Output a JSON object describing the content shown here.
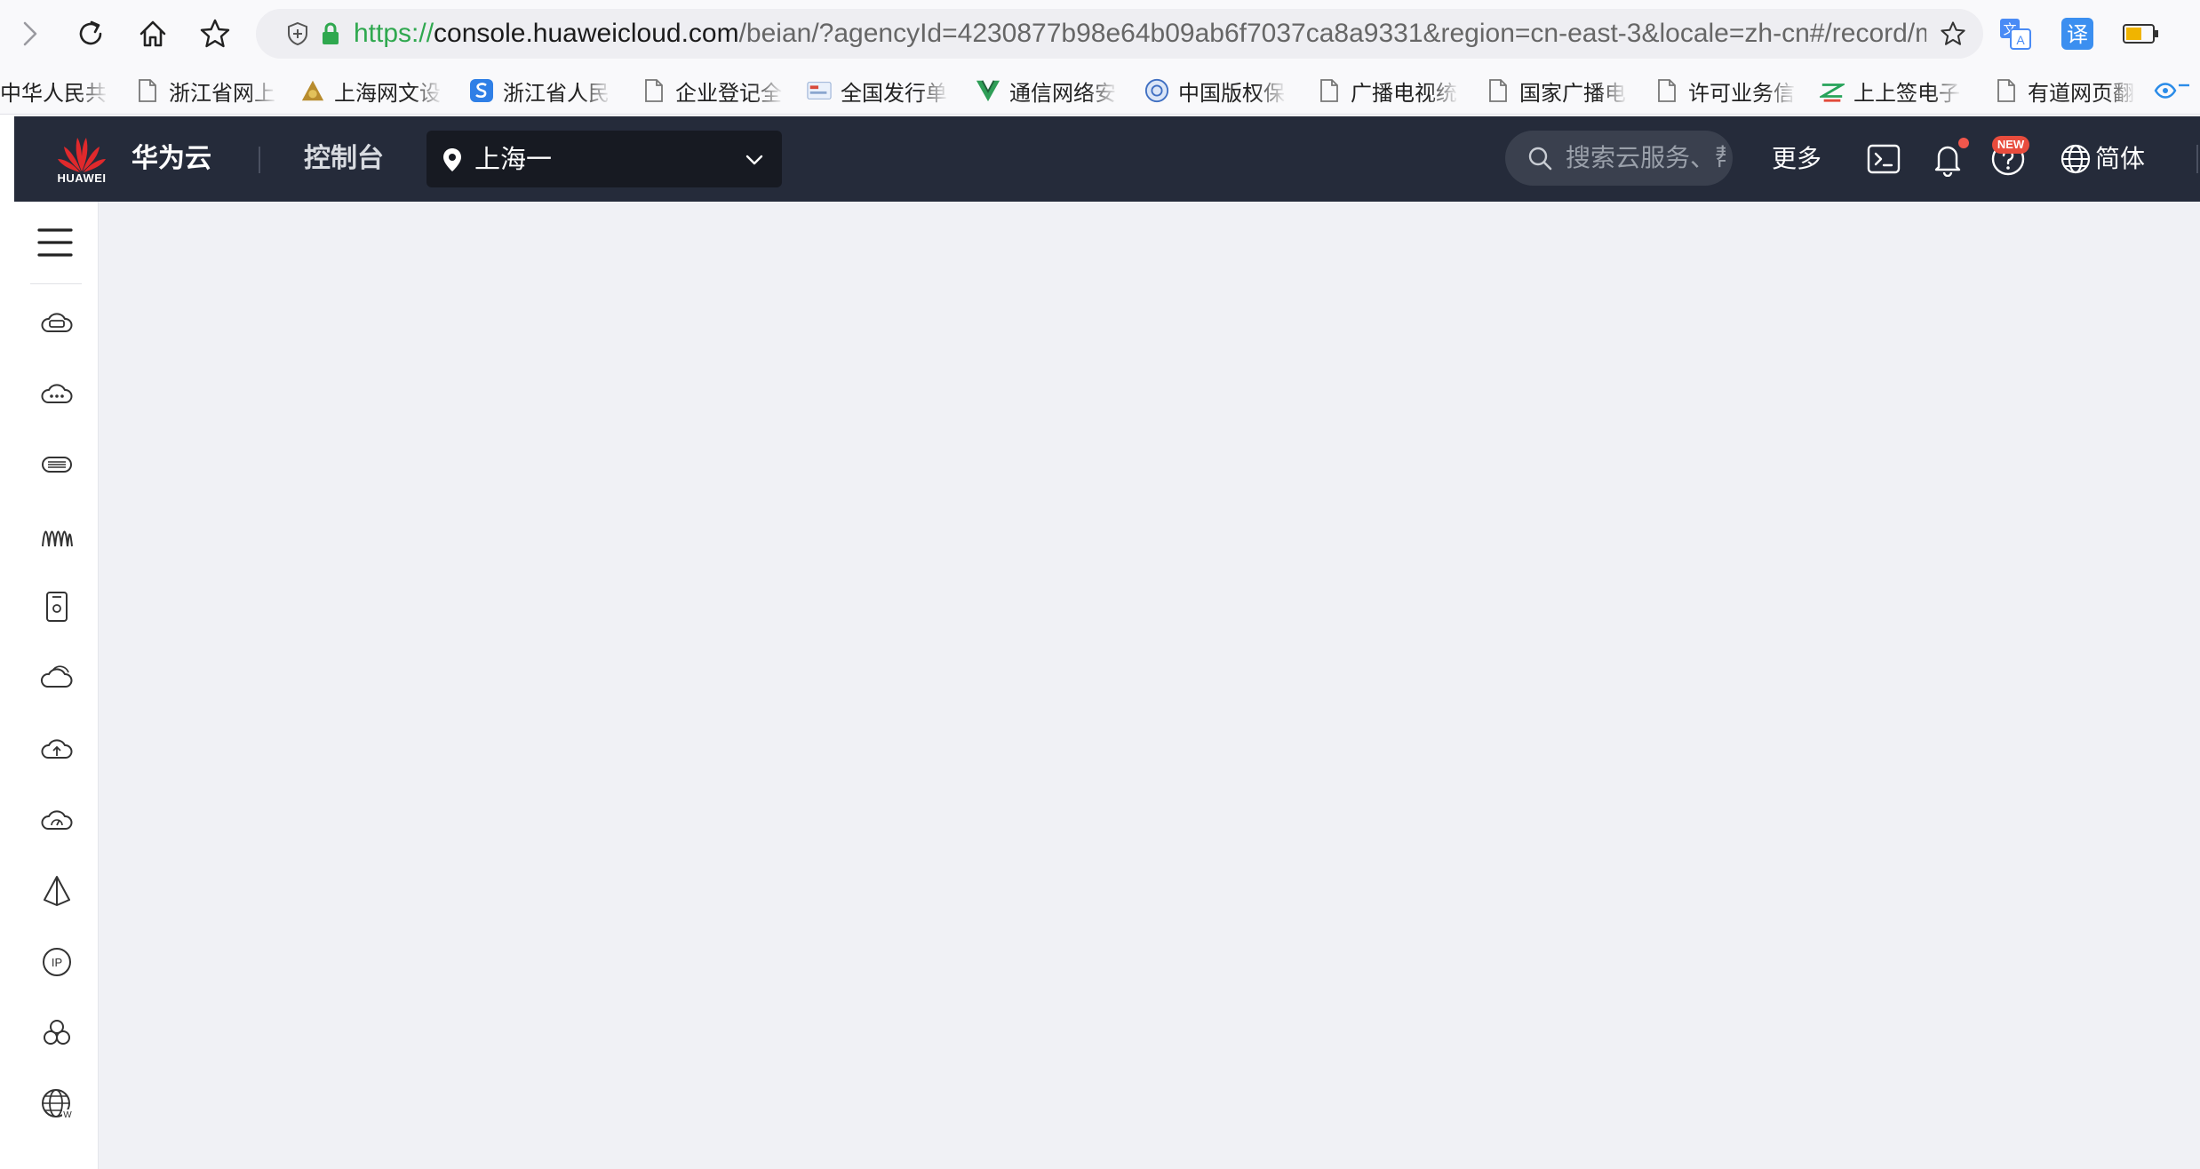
{
  "browser": {
    "url": {
      "scheme": "https://",
      "domain": "console.huaweicloud.com",
      "path": "/beian/?agencyId=4230877b98e64b09ab6f7037ca8a9331&region=cn-east-3&locale=zh-cn#/record/m"
    },
    "bookmarks": [
      {
        "label": "中华人民共"
      },
      {
        "label": "浙江省网上"
      },
      {
        "label": "上海网文设"
      },
      {
        "label": "浙江省人民"
      },
      {
        "label": "企业登记全"
      },
      {
        "label": "全国发行单"
      },
      {
        "label": "通信网络安"
      },
      {
        "label": "中国版权保"
      },
      {
        "label": "广播电视统"
      },
      {
        "label": "国家广播电"
      },
      {
        "label": "许可业务信"
      },
      {
        "label": "上上签电子"
      },
      {
        "label": "有道网页翻"
      }
    ]
  },
  "console": {
    "logo_text": "HUAWEI",
    "brand": "华为云",
    "title": "控制台",
    "region": "上海一",
    "search_placeholder": "搜索云服务、帮",
    "more": "更多",
    "new_badge": "NEW",
    "language": "简体"
  },
  "sidebar": {
    "items": [
      {
        "icon": "ecs-icon"
      },
      {
        "icon": "cloud-more-icon"
      },
      {
        "icon": "bms-icon"
      },
      {
        "icon": "autoscaling-icon"
      },
      {
        "icon": "storage-icon"
      },
      {
        "icon": "cloud-backup-icon"
      },
      {
        "icon": "cloud-upload-icon"
      },
      {
        "icon": "cloud-monitor-icon"
      },
      {
        "icon": "modelarts-icon"
      },
      {
        "icon": "eip-icon"
      },
      {
        "icon": "cluster-icon"
      },
      {
        "icon": "web-globe-icon"
      }
    ]
  },
  "colors": {
    "header_bg": "#252b3a",
    "main_bg": "#f0f1f5",
    "url_green": "#2fa84f"
  }
}
